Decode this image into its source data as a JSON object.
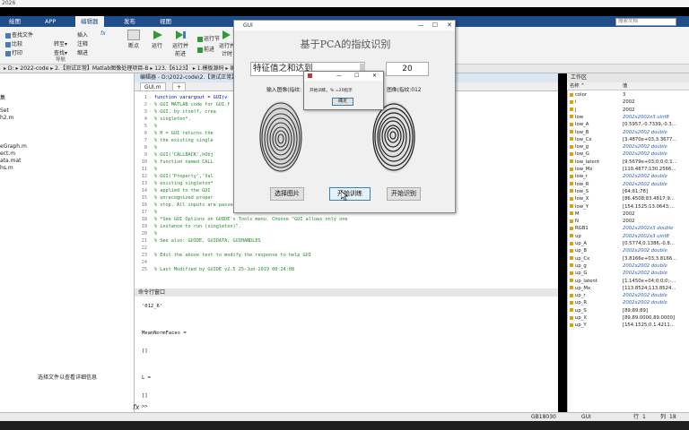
{
  "app": {
    "title_fragment": "2026",
    "tabs": [
      "绘图",
      "APP",
      "编辑器",
      "发布",
      "视图"
    ],
    "active_tab_index": 2,
    "search_placeholder": "搜索文档"
  },
  "ribbon": {
    "file_items": [
      "查找文件",
      "比较",
      "打印"
    ],
    "nav_items": [
      "插入",
      "注释",
      "缩进"
    ],
    "nav_sub": [
      "转至",
      "查找"
    ],
    "nav_goto_label": "转至▾",
    "nav_find_label": "查找▾",
    "nav_fx_label": "fx",
    "breakpoint_label": "断点",
    "run_labels": [
      "运行",
      "运行并前进",
      "运行节",
      "前进",
      "运行并计时"
    ],
    "groups": [
      "导航"
    ]
  },
  "path": {
    "text": "▸  D: ▸ 2022-code ▸ 2.【测试正常】Matlab图像处理项目-B ▸ 123.【6123】 ▸ 1.模板源码 ▸ 编"
  },
  "left_panel": {
    "items": [
      "集",
      "Set",
      "h2.m",
      "",
      "",
      "eGraph.m",
      "ect.m",
      "ata.mat",
      "hs.m"
    ],
    "detail_hint": "选择文件以查看详细信息"
  },
  "editor": {
    "title": "编辑器 - D:\\2022-code\\2.【测试正常】M",
    "tab_label": "GUI.m",
    "tab_add": "+",
    "lines": [
      {
        "n": "1",
        "kw": true,
        "text": "function varargout = GUI(v"
      },
      {
        "n": "2",
        "kw": false,
        "text": "% GUI MATLAB code for GUI.f"
      },
      {
        "n": "3",
        "kw": false,
        "text": "%      GUI, by itself, crea"
      },
      {
        "n": "4",
        "kw": false,
        "text": "%      singleton*."
      },
      {
        "n": "5",
        "kw": false,
        "text": "%"
      },
      {
        "n": "6",
        "kw": false,
        "text": "%      H = GUI returns the"
      },
      {
        "n": "7",
        "kw": false,
        "text": "%      the existing single"
      },
      {
        "n": "8",
        "kw": false,
        "text": "%"
      },
      {
        "n": "9",
        "kw": false,
        "text": "%      GUI('CALLBACK',hObj"
      },
      {
        "n": "10",
        "kw": false,
        "text": "%      function named CALL"
      },
      {
        "n": "11",
        "kw": false,
        "text": "%"
      },
      {
        "n": "12",
        "kw": false,
        "text": "%      GUI('Property','Val"
      },
      {
        "n": "13",
        "kw": false,
        "text": "%      existing singleton*"
      },
      {
        "n": "14",
        "kw": false,
        "text": "%      applied to the GUI"
      },
      {
        "n": "15",
        "kw": false,
        "text": "%      unrecognized proper"
      },
      {
        "n": "16",
        "kw": false,
        "text": "%      stop.  All inputs are passed to GUI_OpeningFcn via varargin."
      },
      {
        "n": "17",
        "kw": false,
        "text": "%"
      },
      {
        "n": "18",
        "kw": false,
        "text": "%      *See GUI Options on GUIDE's Tools menu.  Choose \"GUI allows only one"
      },
      {
        "n": "19",
        "kw": false,
        "text": "%      instance to run (singleton)\"."
      },
      {
        "n": "20",
        "kw": false,
        "text": "%"
      },
      {
        "n": "21",
        "kw": false,
        "text": "% See also: GUIDE, GUIDATA, GUIHANDLES"
      },
      {
        "n": "22",
        "kw": false,
        "text": ""
      },
      {
        "n": "23",
        "kw": false,
        "text": "% Edit the above text to modify the response to help GUI"
      },
      {
        "n": "24",
        "kw": false,
        "text": ""
      },
      {
        "n": "25",
        "kw": false,
        "text": "% Last Modified by GUIDE v2.5 25-Jun-2019 00:24:08"
      }
    ]
  },
  "command_window": {
    "title": "命令行窗口",
    "lines": [
      "'012_6'",
      "",
      "",
      "MeanNormFaces =",
      "",
      "  []",
      "",
      "",
      "L =",
      "",
      "  []"
    ],
    "prompt": ">>",
    "fx": "fx"
  },
  "workspace": {
    "title": "工作区",
    "col_name": "名称 ^",
    "col_value": "值",
    "rows": [
      {
        "name": "color",
        "value": "3",
        "italic": false
      },
      {
        "name": "i",
        "value": "2002",
        "italic": false
      },
      {
        "name": "j",
        "value": "2002",
        "italic": false
      },
      {
        "name": "low",
        "value": "2002x2002x3 uint8",
        "italic": true
      },
      {
        "name": "low_A",
        "value": "[0.5957,-0.7339,-0.3...",
        "italic": false
      },
      {
        "name": "low_B",
        "value": "2002x2002 double",
        "italic": true
      },
      {
        "name": "low_Cx",
        "value": "[3.4870e+03,3.3677...",
        "italic": false
      },
      {
        "name": "low_g",
        "value": "2002x2002 double",
        "italic": true
      },
      {
        "name": "low_G",
        "value": "2002x2002 double",
        "italic": true
      },
      {
        "name": "low_latent",
        "value": "[9.5679e+03;0;0;0;1...",
        "italic": false
      },
      {
        "name": "low_Mx",
        "value": "[110.4877;130.2566...",
        "italic": false
      },
      {
        "name": "low_r",
        "value": "2002x2002 double",
        "italic": true
      },
      {
        "name": "low_R",
        "value": "2002x2002 double",
        "italic": true
      },
      {
        "name": "low_S",
        "value": "[64;61;78]",
        "italic": false
      },
      {
        "name": "low_X",
        "value": "[86.4508;83.4817;9...",
        "italic": false
      },
      {
        "name": "low_Y",
        "value": "[154.1525;13.0643;...",
        "italic": false
      },
      {
        "name": "M",
        "value": "2002",
        "italic": false
      },
      {
        "name": "N",
        "value": "2002",
        "italic": false
      },
      {
        "name": "RGB1",
        "value": "2002x2002x3 double",
        "italic": true
      },
      {
        "name": "up",
        "value": "2002x2002x3 uint8",
        "italic": true
      },
      {
        "name": "up_A",
        "value": "[0.5774,0.1386,-0.8...",
        "italic": false
      },
      {
        "name": "up_B",
        "value": "2002x2002 double",
        "italic": true
      },
      {
        "name": "up_Cx",
        "value": "[3.8166e+03,3.8166...",
        "italic": false
      },
      {
        "name": "up_g",
        "value": "2002x2002 double",
        "italic": true
      },
      {
        "name": "up_G",
        "value": "2002x2002 double",
        "italic": true
      },
      {
        "name": "up_latent",
        "value": "[1.1450e+04;0;0;0;-...",
        "italic": false
      },
      {
        "name": "up_Mx",
        "value": "[113.8524;113.8524...",
        "italic": false
      },
      {
        "name": "up_r",
        "value": "2002x2002 double",
        "italic": true
      },
      {
        "name": "up_R",
        "value": "2002x2002 double",
        "italic": true
      },
      {
        "name": "up_S",
        "value": "[89;89;89]",
        "italic": false
      },
      {
        "name": "up_X",
        "value": "[89.89.0000,89.0000]",
        "italic": false
      },
      {
        "name": "up_Y",
        "value": "[154.1525;0.1.4211...",
        "italic": false
      }
    ]
  },
  "status_bar": {
    "encoding": "GB18030",
    "file_type": "GUI",
    "line_label": "行",
    "line_value": "1",
    "col_label": "列",
    "col_value": "18"
  },
  "gui": {
    "title": "GUI",
    "heading": "基于PCA的指纹识别",
    "field_text": "特征值之和达到",
    "field_value": "20",
    "input_label": "输入图像(指纹:",
    "match_label": "图像(指纹:012",
    "buttons": [
      "选择图片",
      "开始训练",
      "开始识别"
    ],
    "minimize": "—",
    "maximize": "☐",
    "close": "✕"
  },
  "dialog": {
    "message": "开始训练。% =20指示",
    "ok": "确定",
    "minimize": "—",
    "maximize": "☐",
    "close": "✕"
  },
  "colors": {
    "tabbar": "#1f4e8c",
    "comment": "#228b22",
    "keyword": "#0000cc"
  }
}
